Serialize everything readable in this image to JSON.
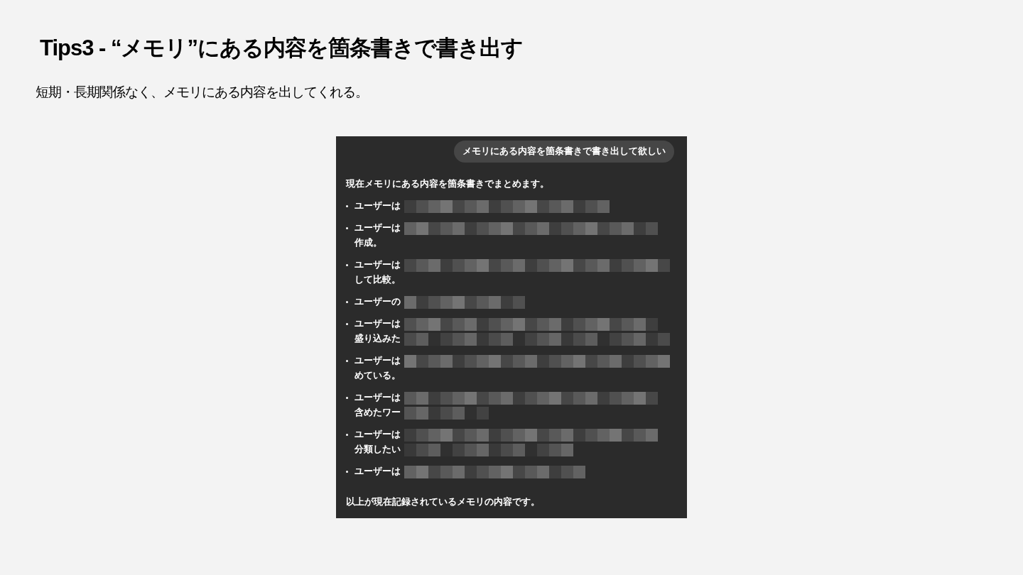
{
  "slide": {
    "title": "Tips3 - “メモリ”にある内容を箇条書きで書き出す",
    "subtitle": "短期・長期関係なく、メモリにある内容を出してくれる。"
  },
  "chat": {
    "user_message": "メモリにある内容を箇条書きで書き出して欲しい",
    "reply_intro": "現在メモリにある内容を箇条書きでまとめます。",
    "items": [
      {
        "lines": [
          "ユーザーは"
        ]
      },
      {
        "lines": [
          "ユーザーは",
          "作成。"
        ]
      },
      {
        "lines": [
          "ユーザーは",
          "して比較。"
        ]
      },
      {
        "lines": [
          "ユーザーの"
        ]
      },
      {
        "lines": [
          "ユーザーは",
          "盛り込みた"
        ]
      },
      {
        "lines": [
          "ユーザーは",
          "めている。"
        ]
      },
      {
        "lines": [
          "ユーザーは",
          "含めたワー"
        ]
      },
      {
        "lines": [
          "ユーザーは",
          "分類したい"
        ]
      },
      {
        "lines": [
          "ユーザーは"
        ]
      }
    ],
    "reply_outro": "以上が現在記録されているメモリの内容です。"
  }
}
